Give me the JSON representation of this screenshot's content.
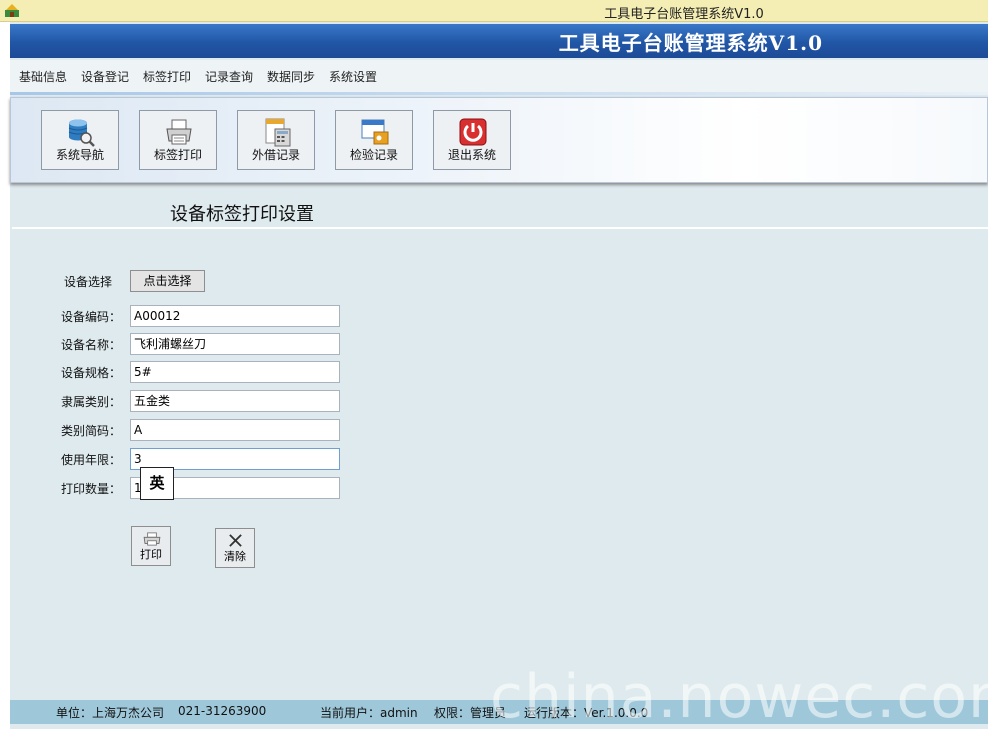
{
  "window": {
    "title": "工具电子台账管理系统V1.0"
  },
  "banner": {
    "title": "工具电子台账管理系统V1.0"
  },
  "menu": {
    "items": [
      "基础信息",
      "设备登记",
      "标签打印",
      "记录查询",
      "数据同步",
      "系统设置"
    ]
  },
  "toolbar": {
    "buttons": [
      {
        "label": "系统导航",
        "icon": "database-search-icon"
      },
      {
        "label": "标签打印",
        "icon": "printer-icon"
      },
      {
        "label": "外借记录",
        "icon": "calculator-icon"
      },
      {
        "label": "检验记录",
        "icon": "window-key-icon"
      },
      {
        "label": "退出系统",
        "icon": "power-icon"
      }
    ]
  },
  "page": {
    "title": "设备标签打印设置",
    "select_label": "设备选择",
    "select_button": "点击选择",
    "fields": [
      {
        "label": "设备编码：",
        "value": "A00012"
      },
      {
        "label": "设备名称：",
        "value": "飞利浦螺丝刀"
      },
      {
        "label": "设备规格：",
        "value": "5#"
      },
      {
        "label": "隶属类别：",
        "value": "五金类"
      },
      {
        "label": "类别简码：",
        "value": "A"
      },
      {
        "label": "使用年限：",
        "value": "3"
      },
      {
        "label": "打印数量：",
        "value": "1"
      }
    ],
    "print_button": "打印",
    "clear_button": "清除",
    "ime_indicator": "英"
  },
  "status": {
    "unit": "单位：上海万杰公司",
    "phone": "021-31263900",
    "user": "当前用户：admin",
    "role": "权限：管理员",
    "version": "运行版本：Ver.1.0.0.0"
  },
  "watermark": "china.nowec.com",
  "colors": {
    "banner": "#2156a6",
    "background": "#dfeaee",
    "statusbar": "#9ec8da",
    "titlebar": "#f4eeb4"
  }
}
